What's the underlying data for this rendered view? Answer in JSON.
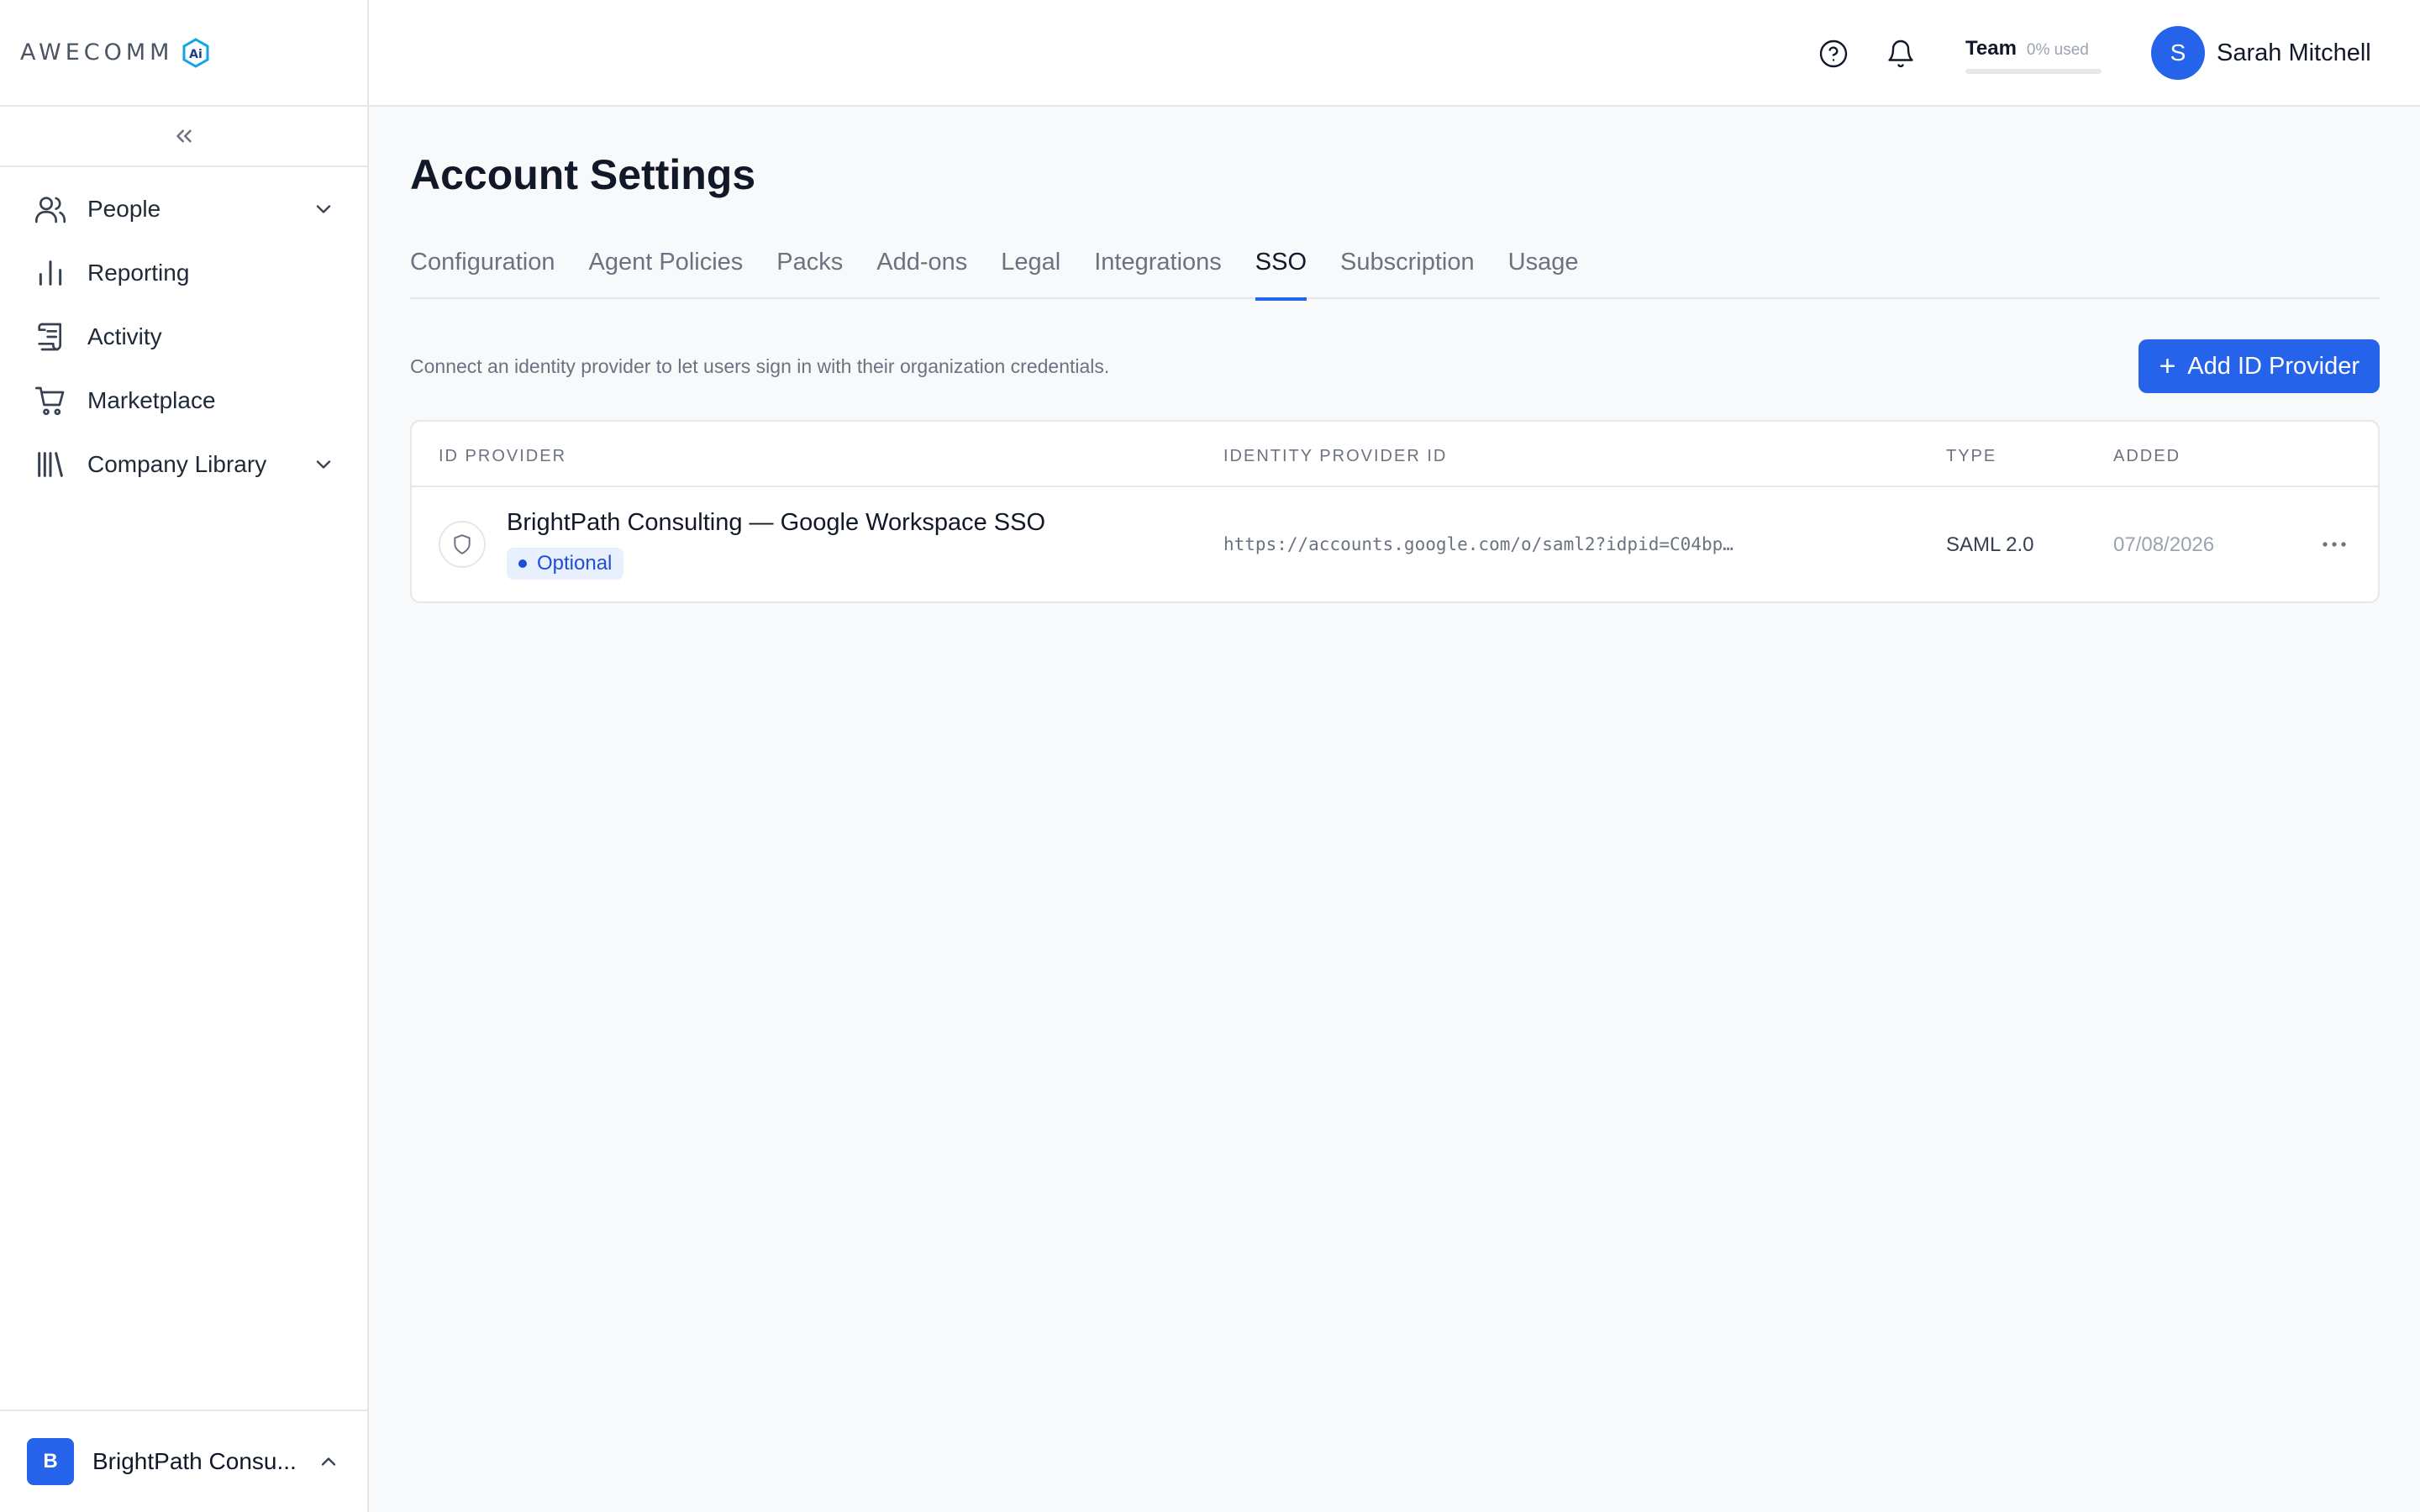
{
  "brand": {
    "logo_text": "AWECOMM",
    "badge_text": "Ai"
  },
  "sidebar": {
    "collapse_icon": "double-chevron-left-icon",
    "items": [
      {
        "label": "People",
        "icon": "people-icon",
        "expandable": true
      },
      {
        "label": "Reporting",
        "icon": "bar-chart-icon",
        "expandable": false
      },
      {
        "label": "Activity",
        "icon": "scroll-icon",
        "expandable": false
      },
      {
        "label": "Marketplace",
        "icon": "cart-icon",
        "expandable": false
      },
      {
        "label": "Company Library",
        "icon": "library-icon",
        "expandable": true
      }
    ],
    "org": {
      "initial": "B",
      "name": "BrightPath Consu..."
    }
  },
  "topbar": {
    "plan_name": "Team",
    "plan_usage": "0% used",
    "plan_usage_fraction": 0,
    "user_initial": "S",
    "user_name": "Sarah Mitchell"
  },
  "page": {
    "title": "Account Settings",
    "tabs": [
      {
        "label": "Configuration",
        "active": false
      },
      {
        "label": "Agent Policies",
        "active": false
      },
      {
        "label": "Packs",
        "active": false
      },
      {
        "label": "Add-ons",
        "active": false
      },
      {
        "label": "Legal",
        "active": false
      },
      {
        "label": "Integrations",
        "active": false
      },
      {
        "label": "SSO",
        "active": true
      },
      {
        "label": "Subscription",
        "active": false
      },
      {
        "label": "Usage",
        "active": false
      }
    ],
    "description": "Connect an identity provider to let users sign in with their organization credentials.",
    "add_button": "Add ID Provider"
  },
  "table": {
    "headers": [
      "ID PROVIDER",
      "IDENTITY PROVIDER ID",
      "TYPE",
      "ADDED"
    ],
    "rows": [
      {
        "name": "BrightPath Consulting — Google Workspace SSO",
        "badge": "Optional",
        "provider_id": "https://accounts.google.com/o/saml2?idpid=C04bp…",
        "type": "SAML 2.0",
        "added": "07/08/2026"
      }
    ]
  },
  "colors": {
    "accent": "#2563eb",
    "badge_bg": "#e8effd",
    "border": "#e5e7eb"
  }
}
